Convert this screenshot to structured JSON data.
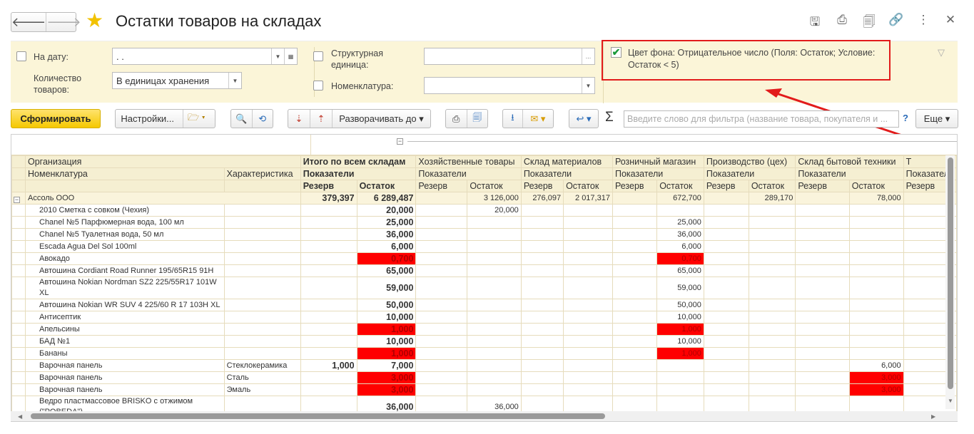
{
  "window": {
    "title": "Остатки товаров на складах",
    "nav": {
      "back": "🡐",
      "forward": "🡒"
    },
    "icons": [
      "save-icon",
      "print-icon",
      "preview-icon",
      "link-icon",
      "more-icon",
      "close-icon"
    ]
  },
  "filters": {
    "date_label": "На дату:",
    "date_value": " .  .",
    "qty_label": "Количество товаров:",
    "qty_value": "В единицах хранения",
    "struct_label": "Структурная единица:",
    "struct_value": "",
    "nom_label": "Номенклатура:",
    "nom_value": "",
    "condition_text": "Цвет фона: Отрицательное число (Поля: Остаток; Условие: Остаток < 5)",
    "condition_checked": true
  },
  "toolbar": {
    "generate": "Сформировать",
    "settings": "Настройки...",
    "expand": "Разворачивать до",
    "search_placeholder": "Введите слово для фильтра (название товара, покупателя и ...",
    "help": "?",
    "more": "Еще"
  },
  "report": {
    "headers": {
      "org": "Организация",
      "nom": "Номенклатура",
      "char": "Характеристика",
      "indicators": "Показатели",
      "reserve": "Резерв",
      "balance": "Остаток",
      "warehouses": [
        "Итого по всем складам",
        "Хозяйственные товары",
        "Склад материалов",
        "Розничный магазин",
        "Производство (цех)",
        "Склад бытовой техники",
        "Т"
      ]
    },
    "group": {
      "name": "Ассоль ООО",
      "values": [
        "379,397",
        "6 289,487",
        "",
        "3 126,000",
        "276,097",
        "2 017,317",
        "",
        "672,700",
        "",
        "289,170",
        "",
        "78,000"
      ]
    },
    "rows": [
      {
        "name": "2010 Сметка с совком (Чехия)",
        "char": "",
        "vals": [
          "",
          "20,000",
          "",
          "20,000",
          "",
          "",
          "",
          "",
          "",
          "",
          "",
          ""
        ],
        "red": []
      },
      {
        "name": "Chanel №5 Парфюмерная вода, 100 мл",
        "char": "",
        "vals": [
          "",
          "25,000",
          "",
          "",
          "",
          "",
          "",
          "25,000",
          "",
          "",
          "",
          ""
        ],
        "red": []
      },
      {
        "name": "Chanel №5 Туалетная вода, 50 мл",
        "char": "",
        "vals": [
          "",
          "36,000",
          "",
          "",
          "",
          "",
          "",
          "36,000",
          "",
          "",
          "",
          ""
        ],
        "red": []
      },
      {
        "name": "Escada Agua Del Sol 100ml",
        "char": "",
        "vals": [
          "",
          "6,000",
          "",
          "",
          "",
          "",
          "",
          "6,000",
          "",
          "",
          "",
          ""
        ],
        "red": []
      },
      {
        "name": "Авокадо",
        "char": "",
        "vals": [
          "",
          "0,700",
          "",
          "",
          "",
          "",
          "",
          "0,700",
          "",
          "",
          "",
          ""
        ],
        "red": [
          1,
          7
        ]
      },
      {
        "name": "Автошина Cordiant Road Runner 195/65R15 91H",
        "char": "",
        "vals": [
          "",
          "65,000",
          "",
          "",
          "",
          "",
          "",
          "65,000",
          "",
          "",
          "",
          ""
        ],
        "red": []
      },
      {
        "name": "Автошина Nokian Nordman SZ2 225/55R17 101W XL",
        "char": "",
        "vals": [
          "",
          "59,000",
          "",
          "",
          "",
          "",
          "",
          "59,000",
          "",
          "",
          "",
          ""
        ],
        "red": [],
        "tall": true
      },
      {
        "name": "Автошина Nokian WR SUV 4 225/60 R 17 103H XL",
        "char": "",
        "vals": [
          "",
          "50,000",
          "",
          "",
          "",
          "",
          "",
          "50,000",
          "",
          "",
          "",
          ""
        ],
        "red": []
      },
      {
        "name": "Антисептик",
        "char": "",
        "vals": [
          "",
          "10,000",
          "",
          "",
          "",
          "",
          "",
          "10,000",
          "",
          "",
          "",
          ""
        ],
        "red": []
      },
      {
        "name": "Апельсины",
        "char": "",
        "vals": [
          "",
          "1,000",
          "",
          "",
          "",
          "",
          "",
          "1,000",
          "",
          "",
          "",
          ""
        ],
        "red": [
          1,
          7
        ]
      },
      {
        "name": "БАД №1",
        "char": "",
        "vals": [
          "",
          "10,000",
          "",
          "",
          "",
          "",
          "",
          "10,000",
          "",
          "",
          "",
          ""
        ],
        "red": []
      },
      {
        "name": "Бананы",
        "char": "",
        "vals": [
          "",
          "1,000",
          "",
          "",
          "",
          "",
          "",
          "1,000",
          "",
          "",
          "",
          ""
        ],
        "red": [
          1,
          7
        ]
      },
      {
        "name": "Варочная панель",
        "char": "Стеклокерамика",
        "vals": [
          "1,000",
          "7,000",
          "",
          "",
          "",
          "",
          "",
          "",
          "",
          "",
          "",
          "6,000"
        ],
        "red": []
      },
      {
        "name": "Варочная панель",
        "char": "Сталь",
        "vals": [
          "",
          "3,000",
          "",
          "",
          "",
          "",
          "",
          "",
          "",
          "",
          "",
          "3,000"
        ],
        "red": [
          1,
          11
        ]
      },
      {
        "name": "Варочная панель",
        "char": "Эмаль",
        "vals": [
          "",
          "3,000",
          "",
          "",
          "",
          "",
          "",
          "",
          "",
          "",
          "",
          "3,000"
        ],
        "red": [
          1,
          11
        ]
      },
      {
        "name": "Ведро пластмассовое BRISKO с отжимом (\"POBEDA\")",
        "char": "",
        "vals": [
          "",
          "36,000",
          "",
          "36,000",
          "",
          "",
          "",
          "",
          "",
          "",
          "",
          ""
        ],
        "red": [],
        "tall": true
      }
    ]
  }
}
